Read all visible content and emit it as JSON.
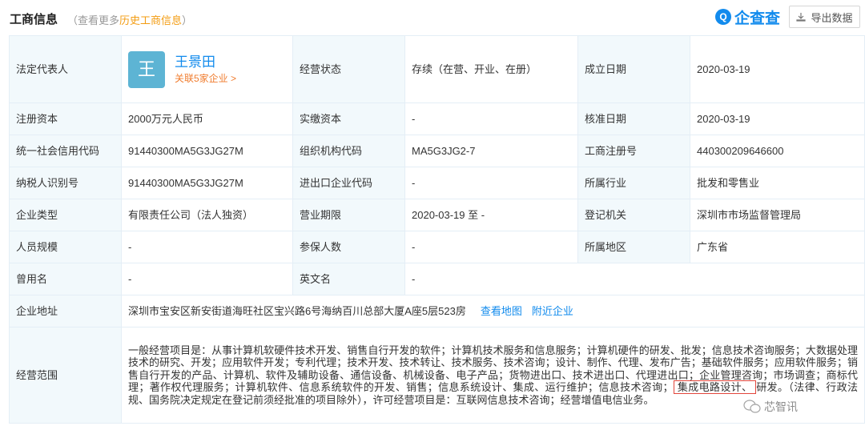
{
  "header": {
    "title": "工商信息",
    "subtitle_prefix": "（查看更多",
    "subtitle_link": "历史工商信息",
    "subtitle_suffix": "）",
    "brand_icon_char": "Q",
    "brand_name": "企查查",
    "export_label": "导出数据"
  },
  "rows": {
    "r1": {
      "label1": "法定代表人",
      "person": {
        "avatar_char": "王",
        "name": "王景田",
        "related": "关联5家企业 >"
      },
      "label2": "经营状态",
      "value2": "存续（在营、开业、在册）",
      "label3": "成立日期",
      "value3": "2020-03-19"
    },
    "r2": {
      "label1": "注册资本",
      "value1": "2000万元人民币",
      "label2": "实缴资本",
      "value2": "-",
      "label3": "核准日期",
      "value3": "2020-03-19"
    },
    "r3": {
      "label1": "统一社会信用代码",
      "value1": "91440300MA5G3JG27M",
      "label2": "组织机构代码",
      "value2": "MA5G3JG2-7",
      "label3": "工商注册号",
      "value3": "440300209646600"
    },
    "r4": {
      "label1": "纳税人识别号",
      "value1": "91440300MA5G3JG27M",
      "label2": "进出口企业代码",
      "value2": "-",
      "label3": "所属行业",
      "value3": "批发和零售业"
    },
    "r5": {
      "label1": "企业类型",
      "value1": "有限责任公司（法人独资）",
      "label2": "营业期限",
      "value2": "2020-03-19 至 -",
      "label3": "登记机关",
      "value3": "深圳市市场监督管理局"
    },
    "r6": {
      "label1": "人员规模",
      "value1": "-",
      "label2": "参保人数",
      "value2": "-",
      "label3": "所属地区",
      "value3": "广东省"
    },
    "r7": {
      "label1": "曾用名",
      "value1": "-",
      "label2": "英文名",
      "value2": "-"
    },
    "r8": {
      "label1": "企业地址",
      "value1": "深圳市宝安区新安街道海旺社区宝兴路6号海纳百川总部大厦A座5层523房",
      "link1": "查看地图",
      "link2": "附近企业"
    },
    "r9": {
      "label1": "经营范围",
      "scope_before": "一般经营项目是：从事计算机软硬件技术开发、销售自行开发的软件；计算机技术服务和信息服务；计算机硬件的研发、批发；信息技术咨询服务；大数据处理技术的研究、开发；应用软件开发；专利代理；技术开发、技术转让、技术服务、技术咨询；设计、制作、代理、发布广告；基础软件服务；应用软件服务；销售自行开发的产品、计算机、软件及辅助设备、通信设备、机械设备、电子产品；货物进出口、技术进出口、代理进出口；企业管理咨询；市场调查；商标代理；著作权代理服务；计算机软件、信息系统软件的开发、销售；信息系统设计、集成、运行维护；信息技术咨询；",
      "scope_highlight": "集成电路设计、",
      "scope_after": "研发。（法律、行政法规、国务院决定规定在登记前须经批准的项目除外），许可经营项目是：互联网信息技术咨询；经营增值电信业务。"
    }
  },
  "watermark": {
    "text": "芯智讯"
  }
}
